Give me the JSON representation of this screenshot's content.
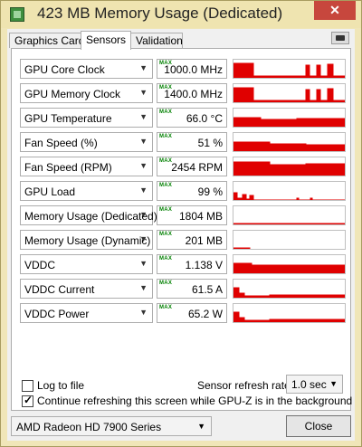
{
  "window": {
    "title": "423 MB Memory Usage (Dedicated)",
    "close_label": "✕"
  },
  "tabs": [
    {
      "label": "Graphics Card",
      "active": false
    },
    {
      "label": "Sensors",
      "active": true
    },
    {
      "label": "Validation",
      "active": false
    }
  ],
  "max_tag": "MAX",
  "sensors": [
    {
      "label": "GPU Core Clock",
      "value": "1000.0 MHz"
    },
    {
      "label": "GPU Memory Clock",
      "value": "1400.0 MHz"
    },
    {
      "label": "GPU Temperature",
      "value": "66.0 °C"
    },
    {
      "label": "Fan Speed (%)",
      "value": "51 %"
    },
    {
      "label": "Fan Speed (RPM)",
      "value": "2454 RPM"
    },
    {
      "label": "GPU Load",
      "value": "99 %"
    },
    {
      "label": "Memory Usage (Dedicated)",
      "value": "1804 MB"
    },
    {
      "label": "Memory Usage (Dynamic)",
      "value": "201 MB"
    },
    {
      "label": "VDDC",
      "value": "1.138 V"
    },
    {
      "label": "VDDC Current",
      "value": "61.5 A"
    },
    {
      "label": "VDDC Power",
      "value": "65.2 W"
    }
  ],
  "log_to_file": {
    "label": "Log to file",
    "checked": false
  },
  "refresh_rate": {
    "label": "Sensor refresh rate:",
    "value": "1.0 sec"
  },
  "continue_refresh": {
    "label": "Continue refreshing this screen while GPU-Z is in the background",
    "checked": true
  },
  "gpu_select": {
    "value": "AMD Radeon HD 7900 Series"
  },
  "close_button": {
    "label": "Close"
  },
  "colors": {
    "graph": "#e00000",
    "max": "#008000"
  },
  "icons": {
    "app": "gpuz-app-icon",
    "camera": "camera-icon",
    "dropdown": "chevron-down-icon"
  }
}
